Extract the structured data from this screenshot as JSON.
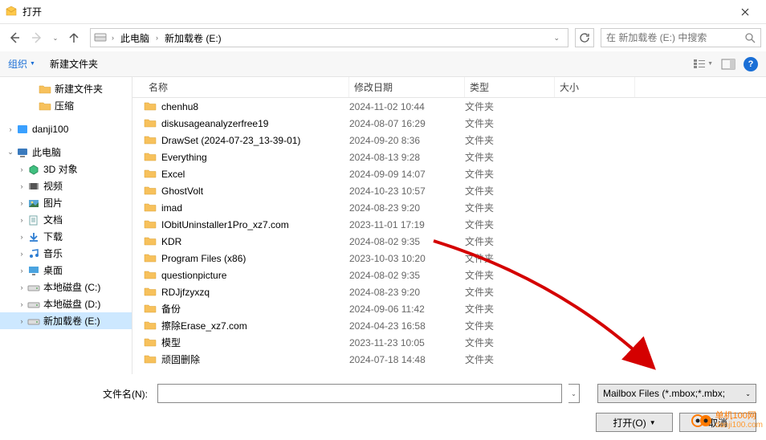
{
  "title": "打开",
  "breadcrumb": {
    "root": "此电脑",
    "current": "新加载卷 (E:)"
  },
  "search": {
    "placeholder": "在 新加载卷 (E:) 中搜索"
  },
  "toolbar": {
    "organize": "组织",
    "newfolder": "新建文件夹"
  },
  "tree": {
    "items": [
      {
        "exp": "",
        "indent": 28,
        "icon": "folder",
        "label": "新建文件夹"
      },
      {
        "exp": "",
        "indent": 28,
        "icon": "folder",
        "label": "压缩"
      },
      {
        "exp": "›",
        "indent": 0,
        "icon": "box",
        "label": "danji100",
        "color": "#3aa0ff"
      },
      {
        "exp": "⌄",
        "indent": 0,
        "icon": "pc",
        "label": "此电脑"
      },
      {
        "exp": "›",
        "indent": 14,
        "icon": "3d",
        "label": "3D 对象"
      },
      {
        "exp": "›",
        "indent": 14,
        "icon": "video",
        "label": "视频"
      },
      {
        "exp": "›",
        "indent": 14,
        "icon": "pictures",
        "label": "图片"
      },
      {
        "exp": "›",
        "indent": 14,
        "icon": "docs",
        "label": "文档"
      },
      {
        "exp": "›",
        "indent": 14,
        "icon": "downloads",
        "label": "下载"
      },
      {
        "exp": "›",
        "indent": 14,
        "icon": "music",
        "label": "音乐"
      },
      {
        "exp": "›",
        "indent": 14,
        "icon": "desktop",
        "label": "桌面"
      },
      {
        "exp": "›",
        "indent": 14,
        "icon": "drive",
        "label": "本地磁盘 (C:)"
      },
      {
        "exp": "›",
        "indent": 14,
        "icon": "drive",
        "label": "本地磁盘 (D:)"
      },
      {
        "exp": "›",
        "indent": 14,
        "icon": "drive",
        "label": "新加载卷 (E:)",
        "selected": true
      }
    ]
  },
  "columns": {
    "name": "名称",
    "date": "修改日期",
    "type": "类型",
    "size": "大小"
  },
  "files": [
    {
      "name": "chenhu8",
      "date": "2024-11-02 10:44",
      "type": "文件夹"
    },
    {
      "name": "diskusageanalyzerfree19",
      "date": "2024-08-07 16:29",
      "type": "文件夹"
    },
    {
      "name": "DrawSet (2024-07-23_13-39-01)",
      "date": "2024-09-20 8:36",
      "type": "文件夹"
    },
    {
      "name": "Everything",
      "date": "2024-08-13 9:28",
      "type": "文件夹"
    },
    {
      "name": "Excel",
      "date": "2024-09-09 14:07",
      "type": "文件夹"
    },
    {
      "name": "GhostVolt",
      "date": "2024-10-23 10:57",
      "type": "文件夹"
    },
    {
      "name": "imad",
      "date": "2024-08-23 9:20",
      "type": "文件夹"
    },
    {
      "name": "IObitUninstaller1Pro_xz7.com",
      "date": "2023-11-01 17:19",
      "type": "文件夹"
    },
    {
      "name": "KDR",
      "date": "2024-08-02 9:35",
      "type": "文件夹"
    },
    {
      "name": "Program Files (x86)",
      "date": "2023-10-03 10:20",
      "type": "文件夹"
    },
    {
      "name": "questionpicture",
      "date": "2024-08-02 9:35",
      "type": "文件夹"
    },
    {
      "name": "RDJjfzyxzq",
      "date": "2024-08-23 9:20",
      "type": "文件夹"
    },
    {
      "name": "备份",
      "date": "2024-09-06 11:42",
      "type": "文件夹"
    },
    {
      "name": "擦除Erase_xz7.com",
      "date": "2024-04-23 16:58",
      "type": "文件夹"
    },
    {
      "name": "模型",
      "date": "2023-11-23 10:05",
      "type": "文件夹"
    },
    {
      "name": "顽固删除",
      "date": "2024-07-18 14:48",
      "type": "文件夹"
    }
  ],
  "footer": {
    "filename_label": "文件名(N):",
    "filter": "Mailbox Files (*.mbox;*.mbx;",
    "open": "打开(O)",
    "cancel": "取消"
  },
  "watermark": {
    "text1": "单机100网",
    "text2": "danji100.com"
  }
}
